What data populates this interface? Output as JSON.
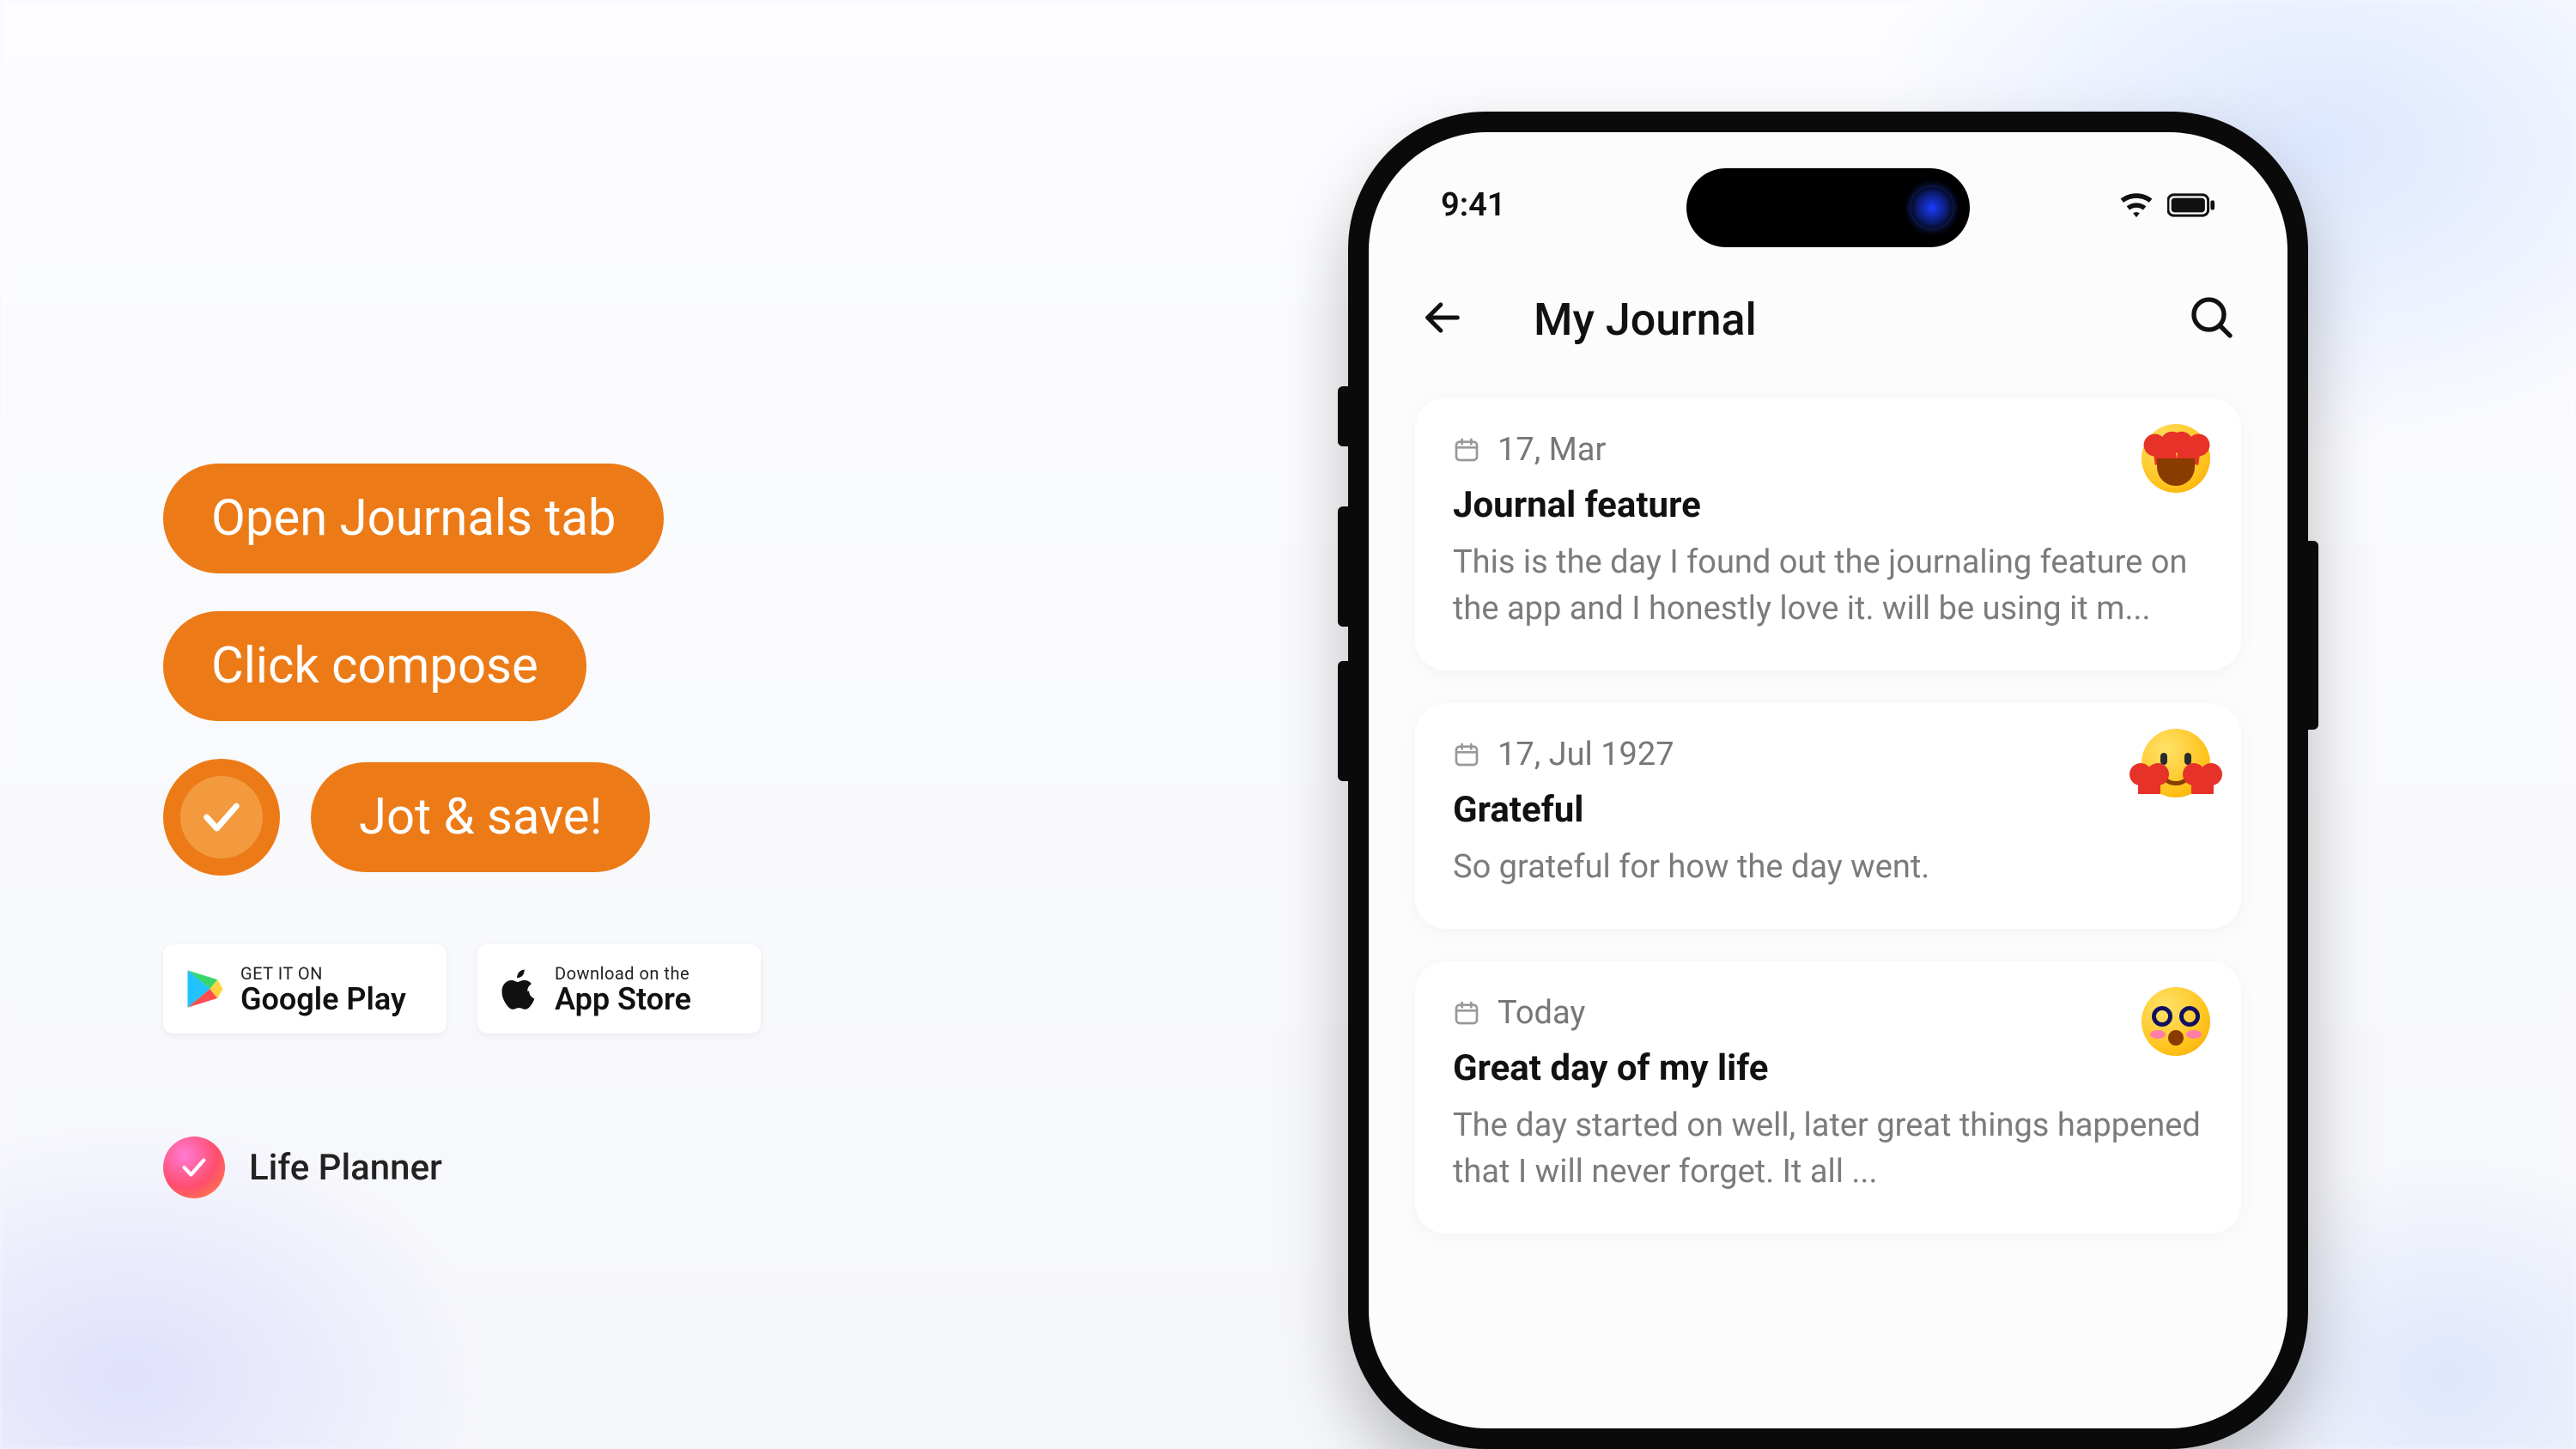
{
  "promo": {
    "steps": [
      "Open Journals tab",
      "Click compose",
      "Jot & save!"
    ],
    "icon": "check-icon"
  },
  "stores": {
    "google": {
      "line1": "GET IT ON",
      "line2": "Google Play"
    },
    "apple": {
      "line1": "Download on the",
      "line2": "App Store"
    }
  },
  "brand": {
    "name": "Life Planner"
  },
  "colors": {
    "accent": "#ec7b17"
  },
  "phone": {
    "status": {
      "time": "9:41"
    },
    "appbar": {
      "title": "My Journal"
    },
    "entries": [
      {
        "date": "17, Mar",
        "title": "Journal feature",
        "body": "This is the day I found out the journaling feature on the app and I honestly love it. will be using it m...",
        "mood": "heart-eyes"
      },
      {
        "date": "17, Jul 1927",
        "title": "Grateful",
        "body": "So grateful for how the day went.",
        "mood": "hugging"
      },
      {
        "date": "Today",
        "title": "Great day of my life",
        "body": "The day started on well, later great things happened that I will never forget. It all ...",
        "mood": "flushed"
      }
    ]
  }
}
